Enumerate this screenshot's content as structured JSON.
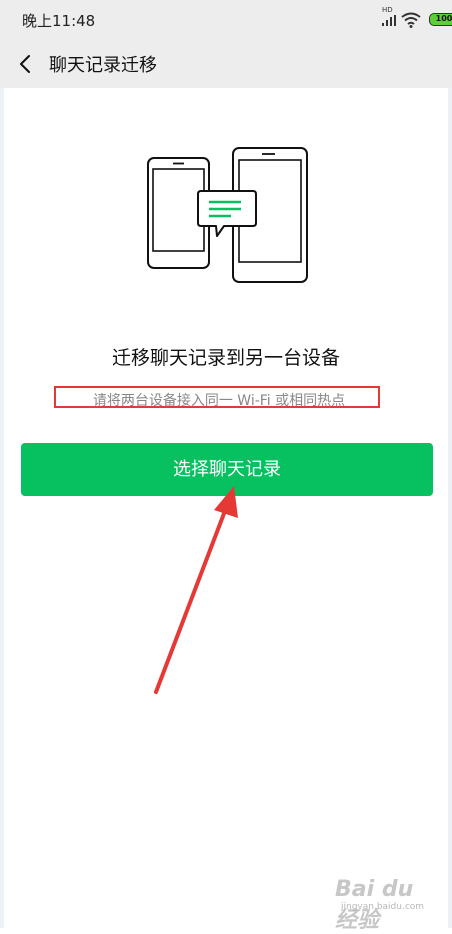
{
  "status_bar": {
    "time": "晚上11:48",
    "hd_label": "HD",
    "battery_level": "100"
  },
  "header": {
    "title": "聊天记录迁移",
    "back_icon": "chevron-left-icon"
  },
  "main": {
    "illustration_icon": "phones-chat-transfer-icon",
    "heading": "迁移聊天记录到另一台设备",
    "hint": "请将两台设备接入同一 Wi-Fi 或相同热点",
    "primary_button_label": "选择聊天记录"
  },
  "watermark": {
    "brand": "Bai du 经验",
    "site": "jingyan.baidu.com"
  },
  "colors": {
    "accent_green": "#07c160",
    "annotation_red": "#e53935",
    "bar_background": "#ededed"
  }
}
